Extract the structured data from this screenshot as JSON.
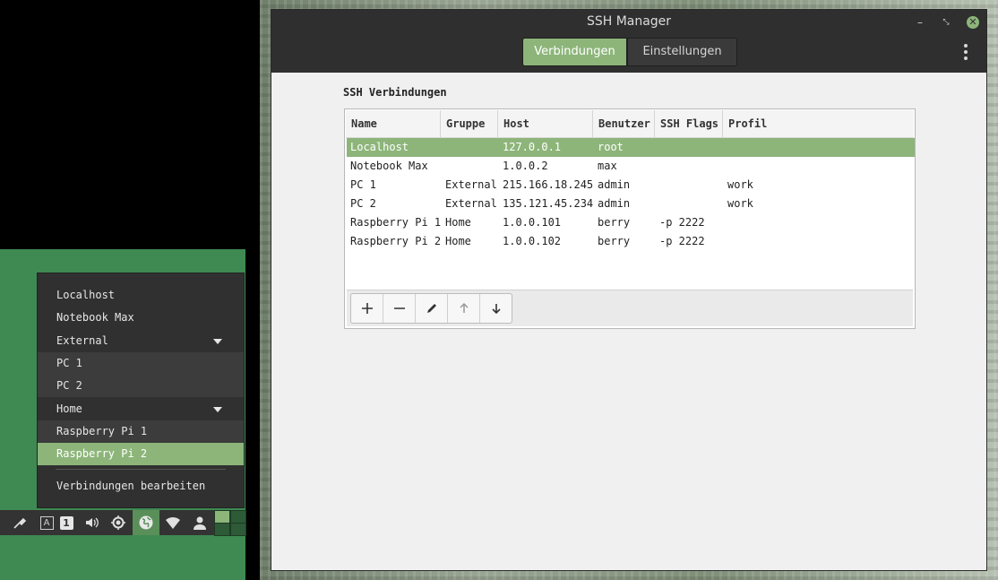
{
  "window": {
    "title": "SSH Manager",
    "tabs": [
      {
        "label": "Verbindungen",
        "active": true
      },
      {
        "label": "Einstellungen",
        "active": false
      }
    ],
    "controls": {
      "minimize": "–",
      "maximize": "⤡",
      "close": "✕"
    }
  },
  "section_title": "SSH Verbindungen",
  "table": {
    "columns": [
      "Name",
      "Gruppe",
      "Host",
      "Benutzer",
      "SSH Flags",
      "Profil"
    ],
    "rows": [
      {
        "name": "Localhost",
        "group": "",
        "host": "127.0.0.1",
        "user": "root",
        "flags": "",
        "profile": "",
        "selected": true
      },
      {
        "name": "Notebook Max",
        "group": "",
        "host": "1.0.0.2",
        "user": "max",
        "flags": "",
        "profile": "",
        "selected": false
      },
      {
        "name": "PC 1",
        "group": "External",
        "host": "215.166.18.245",
        "user": "admin",
        "flags": "",
        "profile": "work",
        "selected": false
      },
      {
        "name": "PC 2",
        "group": "External",
        "host": "135.121.45.234",
        "user": "admin",
        "flags": "",
        "profile": "work",
        "selected": false
      },
      {
        "name": "Raspberry Pi 1",
        "group": "Home",
        "host": "1.0.0.101",
        "user": "berry",
        "flags": "-p 2222",
        "profile": "",
        "selected": false
      },
      {
        "name": "Raspberry Pi 2",
        "group": "Home",
        "host": "1.0.0.102",
        "user": "berry",
        "flags": "-p 2222",
        "profile": "",
        "selected": false
      }
    ],
    "toolbar_icons": [
      "add-icon",
      "remove-icon",
      "edit-icon",
      "move-up-icon",
      "move-down-icon"
    ]
  },
  "menu": {
    "items": [
      {
        "label": "Localhost",
        "kind": "item"
      },
      {
        "label": "Notebook Max",
        "kind": "item"
      },
      {
        "label": "External",
        "kind": "group"
      },
      {
        "label": "PC 1",
        "kind": "sub"
      },
      {
        "label": "PC 2",
        "kind": "sub"
      },
      {
        "label": "Home",
        "kind": "group"
      },
      {
        "label": "Raspberry Pi 1",
        "kind": "sub"
      },
      {
        "label": "Raspberry Pi 2",
        "kind": "sub-highlighted"
      }
    ],
    "footer": "Verbindungen bearbeiten"
  },
  "panel": {
    "icons": [
      "color-picker-icon",
      "keyboard-layout-icon",
      "workspace-number-icon",
      "volume-icon",
      "brightness-icon",
      "network-globe-icon",
      "wifi-icon",
      "user-icon"
    ],
    "keyboard_label": "A",
    "workspace_number": "1"
  },
  "colors": {
    "accent": "#8db57a",
    "titlebar": "#2f2f2f",
    "menu_bg": "#303030",
    "desktop_green": "#3e8a52"
  }
}
